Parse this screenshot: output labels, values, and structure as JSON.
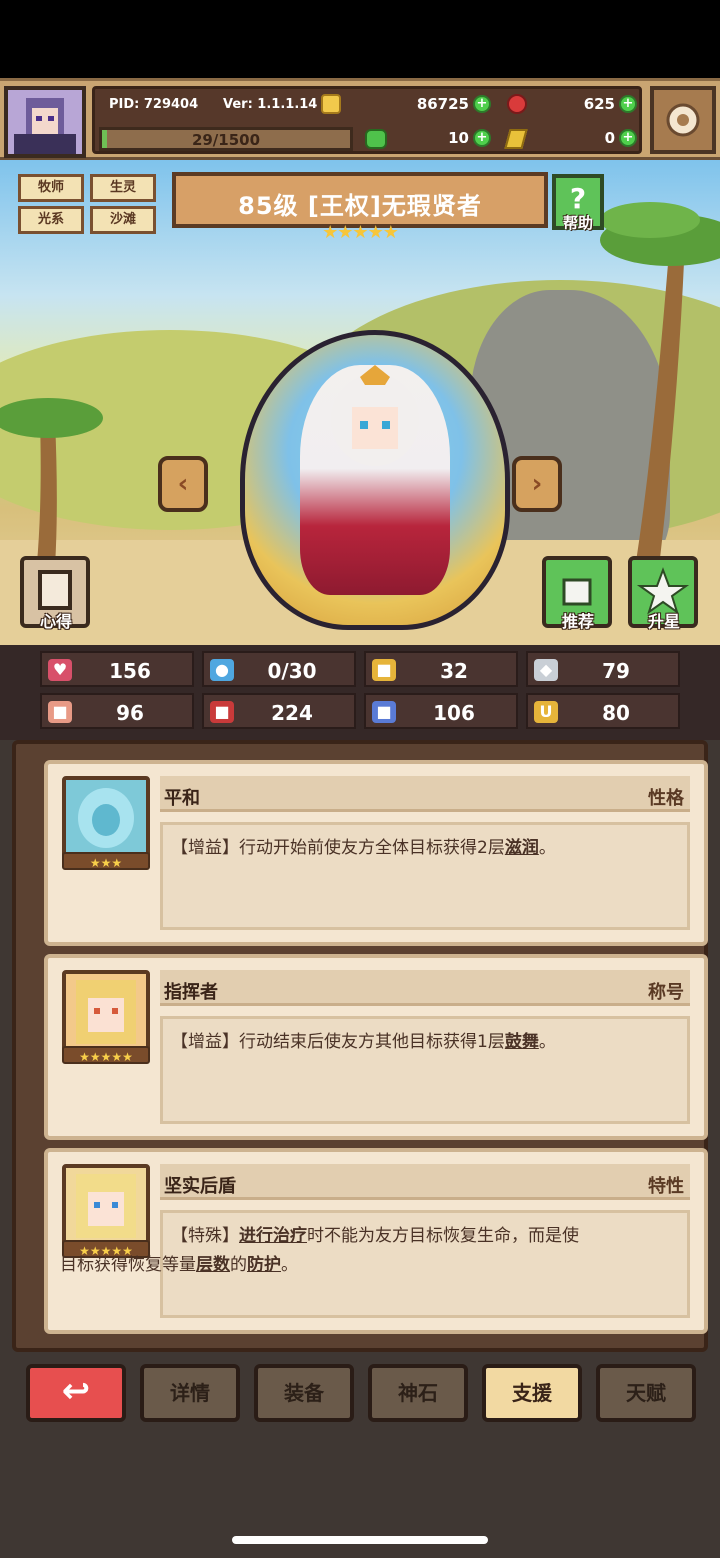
{
  "topbar": {
    "pid_label": "PID: 729404",
    "version_label": "Ver: 1.1.1.14",
    "gold": "86725",
    "gems": "625",
    "xp_text": "29/1500",
    "xp_progress": 0.0193,
    "clover": "10",
    "key": "0"
  },
  "hero": {
    "tags": [
      "牧师",
      "生灵",
      "光系",
      "沙滩"
    ],
    "title": "85级 [王权]无瑕贤者",
    "stars": "★★★★★",
    "help_label": "帮助",
    "heart_label": "心得",
    "recommend_label": "推荐",
    "starup_label": "升星"
  },
  "stats": [
    {
      "icon": "heart-icon",
      "value": "156"
    },
    {
      "icon": "water-drop-icon",
      "value": "0/30"
    },
    {
      "icon": "shield-icon",
      "value": "32"
    },
    {
      "icon": "wing-icon",
      "value": "79"
    },
    {
      "icon": "fist-icon",
      "value": "96"
    },
    {
      "icon": "book-icon",
      "value": "224"
    },
    {
      "icon": "armor-icon",
      "value": "106"
    },
    {
      "icon": "magnet-icon",
      "value": "80"
    }
  ],
  "cards": [
    {
      "name": "平和",
      "type": "性格",
      "stars": "★★★"
    },
    {
      "name": "指挥者",
      "type": "称号",
      "stars": "★★★★★"
    },
    {
      "name": "坚实后盾",
      "type": "特性",
      "stars": "★★★★★"
    }
  ],
  "card_text": {
    "c1_prefix": "【增益】行动开始前使友方全体目标获得2层",
    "c1_term": "滋润",
    "c1_suffix": "。",
    "c2_prefix": "【增益】行动结束后使友方其他目标获得1层",
    "c2_term": "鼓舞",
    "c2_suffix": "。",
    "c3_p1": "【特殊】",
    "c3_term1": "进行治疗",
    "c3_p2": "时不能为友方目标恢复生命，而是使",
    "c3_p3": "目标获得恢复等量",
    "c3_term2": "层数",
    "c3_p4": "的",
    "c3_term3": "防护",
    "c3_p5": "。"
  },
  "tabs": {
    "back_icon": "↩",
    "details": "详情",
    "equipment": "装备",
    "godstone": "神石",
    "support": "支援",
    "talent": "天赋"
  },
  "colors": {
    "accent_green": "#4fcf4c",
    "panel_brown": "#5b4131",
    "active_tab": "#f2d9a2",
    "back_red": "#e74f4f"
  }
}
